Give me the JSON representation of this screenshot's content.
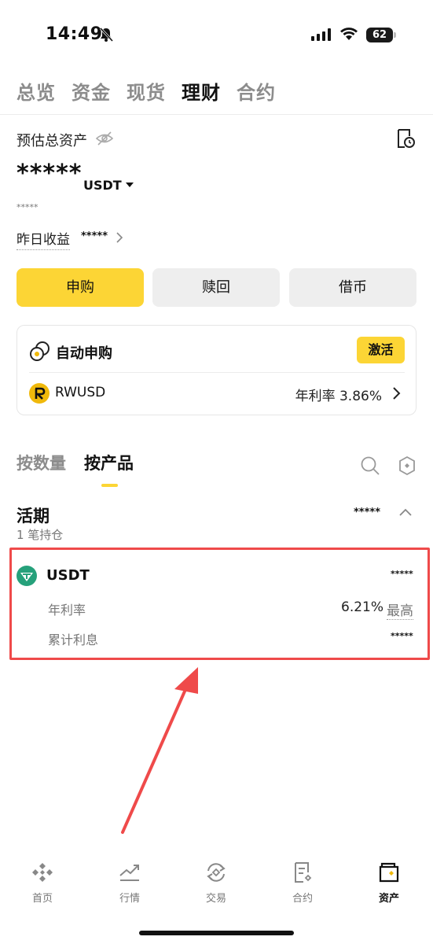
{
  "status_bar": {
    "time": "14:49",
    "battery": "62"
  },
  "top_tabs": [
    {
      "label": "总览",
      "active": false
    },
    {
      "label": "资金",
      "active": false
    },
    {
      "label": "现货",
      "active": false
    },
    {
      "label": "理财",
      "active": true
    },
    {
      "label": "合约",
      "active": false
    }
  ],
  "summary": {
    "est_label": "预估总资产",
    "total_value": "*****",
    "currency": "USDT",
    "sub_value": "*****",
    "yesterday_label": "昨日收益",
    "yesterday_value": "*****"
  },
  "actions": {
    "subscribe": "申购",
    "redeem": "赎回",
    "borrow": "借币"
  },
  "auto_subscribe": {
    "title": "自动申购",
    "activate_label": "激活",
    "product_name": "RWUSD",
    "apr_text": "年利率 3.86%"
  },
  "product_tabs": [
    {
      "label": "按数量",
      "active": false
    },
    {
      "label": "按产品",
      "active": true
    }
  ],
  "flexible": {
    "title": "活期",
    "count": "1 笔持仓",
    "amount": "*****",
    "item": {
      "name": "USDT",
      "amount": "*****",
      "rate_label": "年利率",
      "rate_value": "6.21%",
      "rate_max": "最高",
      "interest_label": "累计利息",
      "interest_value": "*****"
    }
  },
  "bottom_nav": [
    {
      "label": "首页",
      "icon": "home-icon",
      "active": false
    },
    {
      "label": "行情",
      "icon": "markets-icon",
      "active": false
    },
    {
      "label": "交易",
      "icon": "trade-icon",
      "active": false
    },
    {
      "label": "合约",
      "icon": "futures-icon",
      "active": false
    },
    {
      "label": "资产",
      "icon": "wallet-icon",
      "active": true
    }
  ],
  "colors": {
    "accent": "#fcd535",
    "highlight": "#ef4a4a",
    "usdt": "#26a17b"
  }
}
